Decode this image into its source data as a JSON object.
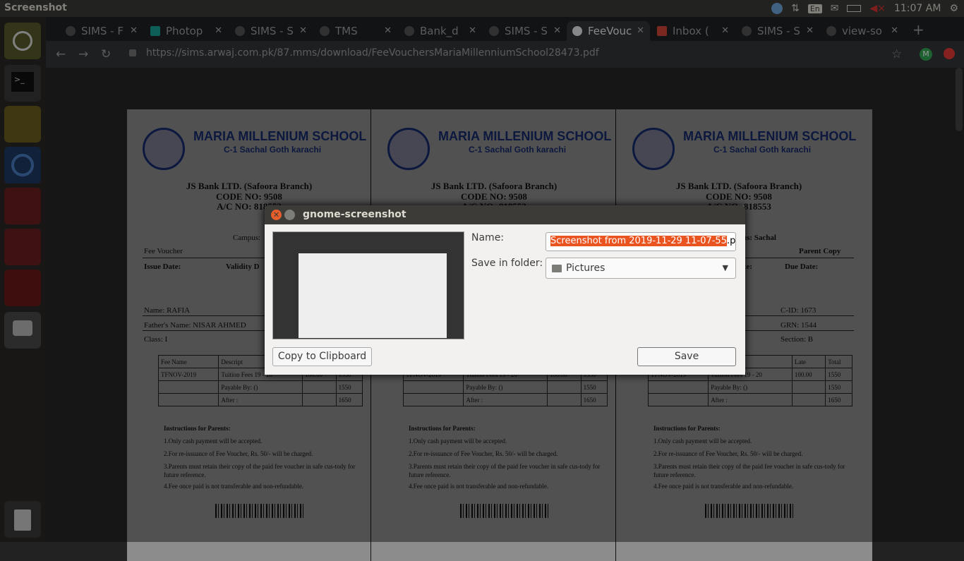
{
  "top_panel": {
    "title": "Screenshot",
    "lang": "En",
    "clock": "11:07 AM"
  },
  "launcher": {
    "items": [
      "ubuntu-dash",
      "terminal",
      "teapot-app",
      "chromium",
      "files",
      "file-viewer",
      "wine",
      "screenshot"
    ],
    "trash": "trash"
  },
  "browser": {
    "tabs": [
      {
        "label": "SIMS - F",
        "active": false
      },
      {
        "label": "Photop",
        "active": false
      },
      {
        "label": "SIMS - S",
        "active": false
      },
      {
        "label": "TMS",
        "active": false
      },
      {
        "label": "Bank_d",
        "active": false
      },
      {
        "label": "SIMS - S",
        "active": false
      },
      {
        "label": "FeeVouc",
        "active": true
      },
      {
        "label": "Inbox (",
        "active": false
      },
      {
        "label": "SIMS - S",
        "active": false
      },
      {
        "label": "view-so",
        "active": false
      }
    ],
    "url": "https://sims.arwaj.com.pk/87.mms/download/FeeVouchersMariaMillenniumSchool28473.pdf",
    "profile_initial": "M"
  },
  "vouchers": [
    {
      "school": "MARIA MILLENIUM SCHOOL",
      "address": "C-1 Sachal Goth karachi",
      "bank": "JS Bank LTD. (Safoora Branch)",
      "code": "CODE NO: 9508",
      "account": "A/C NO: 818553",
      "campus": "Campus:",
      "copy_label": "Fee Voucher",
      "issue_date": "Issue Date:",
      "validity": "Validity D",
      "name": "Name: RAFIA",
      "father": "Father's Name: NISAR AHMED",
      "class": "Class: I",
      "table": {
        "headers": [
          "Fee Name",
          "Descript",
          "",
          ""
        ],
        "rows": [
          [
            "TFNOV-2019",
            "Tuition Fees 19 - 20",
            "100.00",
            "1550"
          ],
          [
            "",
            "Payable By: ()",
            "",
            "1550"
          ],
          [
            "",
            "After :",
            "",
            "1650"
          ]
        ]
      }
    },
    {
      "school": "MARIA MILLENIUM SCHOOL",
      "address": "C-1 Sachal Goth karachi",
      "bank": "JS Bank LTD. (Safoora Branch)",
      "code": "CODE NO: 9508",
      "account": "A/C NO: 818553",
      "campus": "",
      "copy_label": "",
      "issue_date": "",
      "validity": "",
      "name": "",
      "father": "",
      "class": "",
      "table": {
        "headers": [
          "",
          "",
          "",
          ""
        ],
        "rows": [
          [
            "TFNOV-2019",
            "Tuition Fees 19 - 20",
            "100.00",
            "1550"
          ],
          [
            "",
            "Payable By: ()",
            "",
            "1550"
          ],
          [
            "",
            "After :",
            "",
            "1650"
          ]
        ]
      }
    },
    {
      "school": "MARIA MILLENIUM SCHOOL",
      "address": "C-1 Sachal Goth karachi",
      "bank": "JS Bank LTD. (Safoora Branch)",
      "code": "CODE NO: 9508",
      "account": "A/C NO: 818553",
      "campus": "us: Sachal",
      "copy_label": "Parent Copy",
      "issue_date": "y Date:",
      "validity": "Due Date:",
      "name": "C-ID: 1673",
      "father": "GRN: 1544",
      "class": "Section: B",
      "table": {
        "headers": [
          "",
          "ription",
          "Late",
          "Total"
        ],
        "rows": [
          [
            "TFNOV-2019",
            "Tuition Fees 19 - 20",
            "100.00",
            "1550"
          ],
          [
            "",
            "Payable By: ()",
            "",
            "1550"
          ],
          [
            "",
            "After :",
            "",
            "1650"
          ]
        ]
      }
    }
  ],
  "instructions": {
    "title": "Instructions for Parents:",
    "items": [
      "1.Only cash payment will be accepted.",
      "2.For re-issuance of Fee Voucher, Rs. 50/- will be charged.",
      "3.Parents must retain their copy of the paid fee voucher in safe cus-tody for future reference.",
      "4.Fee once paid is not transferable and non-refundable."
    ]
  },
  "dialog": {
    "title": "gnome-screenshot",
    "name_label": "Name:",
    "name_value": "Screenshot from 2019-11-29 11-07-55",
    "name_ext": ".p",
    "folder_label": "Save in folder:",
    "folder_value": "Pictures",
    "copy_button": "Copy to Clipboard",
    "save_button": "Save"
  }
}
